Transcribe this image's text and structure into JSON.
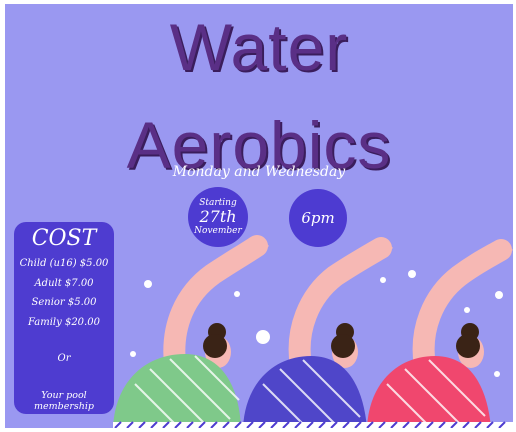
{
  "poster": {
    "title_line1": "Water",
    "title_line2": "Aerobics",
    "subtitle": "Monday and Wednesday",
    "start": {
      "line1": "Starting",
      "line2": "27th",
      "line3": "November"
    },
    "time": "6pm",
    "cost": {
      "heading": "COST",
      "items": [
        "Child (u16) $5.00",
        "Adult $7.00",
        "Senior $5.00",
        "Family $20.00"
      ],
      "or": "Or",
      "membership": "Your pool membership"
    },
    "colors": {
      "background": "#9a98f1",
      "title": "#5a2f86",
      "accent": "#4e3cd0",
      "swimsuit_green": "#7fc98a",
      "swimsuit_blue": "#4f46c9",
      "swimsuit_red": "#f0476e",
      "skin": "#f6b8b4",
      "hair": "#3a2316"
    }
  }
}
